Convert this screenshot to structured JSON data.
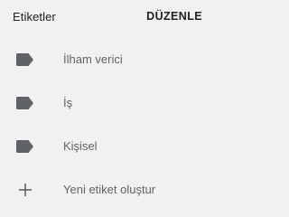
{
  "header": {
    "title": "Etiketler",
    "edit_label": "DÜZENLE"
  },
  "labels": [
    {
      "name": "İlham verici",
      "icon": "label-icon"
    },
    {
      "name": "İş",
      "icon": "label-icon"
    },
    {
      "name": "Kişisel",
      "icon": "label-icon"
    }
  ],
  "create": {
    "label": "Yeni etiket oluştur",
    "icon": "plus-icon"
  },
  "colors": {
    "background": "#f1f1f1",
    "icon": "#5f6368",
    "label_text": "#5f6368",
    "header_text": "#202124"
  }
}
